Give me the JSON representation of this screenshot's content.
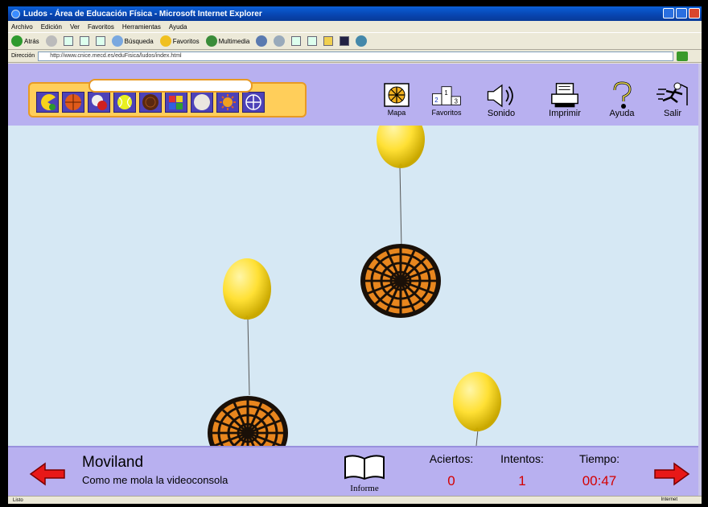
{
  "window": {
    "title": "Ludos - Área de Educación Física - Microsoft Internet Explorer"
  },
  "menu": [
    "Archivo",
    "Edición",
    "Ver",
    "Favoritos",
    "Herramientas",
    "Ayuda"
  ],
  "toolbar": {
    "back_label": "Atrás",
    "search_label": "Búsqueda",
    "favorites_label": "Favoritos",
    "multimedia_label": "Multimedia"
  },
  "address": {
    "label": "Dirección",
    "url": "http://www.cnice.mecd.es/eduFisica/ludos/index.html"
  },
  "header_tools": {
    "mapa": "Mapa",
    "favoritos": "Favoritos",
    "sonido": "Sonido",
    "imprimir": "Imprimir",
    "ayuda": "Ayuda",
    "salir": "Salir"
  },
  "palette": {
    "items": [
      "pacman",
      "basketball",
      "hitball",
      "tennis",
      "ball-dark",
      "blocks",
      "ball-white",
      "sun",
      "target"
    ],
    "accent_color": "#ffce5a",
    "item_bg_color": "#4d42b8"
  },
  "game": {
    "title": "Moviland",
    "subtitle": "Como me mola la videoconsola",
    "informe_label": "Informe",
    "aciertos_label": "Aciertos:",
    "aciertos_value": "0",
    "intentos_label": "Intentos:",
    "intentos_value": "1",
    "tiempo_label": "Tiempo:",
    "tiempo_value": "00:47",
    "balloon_color": "#ffe34a",
    "background_color": "#d6e8f4"
  },
  "statusbar": {
    "left": "Listo",
    "zone": "Internet"
  }
}
